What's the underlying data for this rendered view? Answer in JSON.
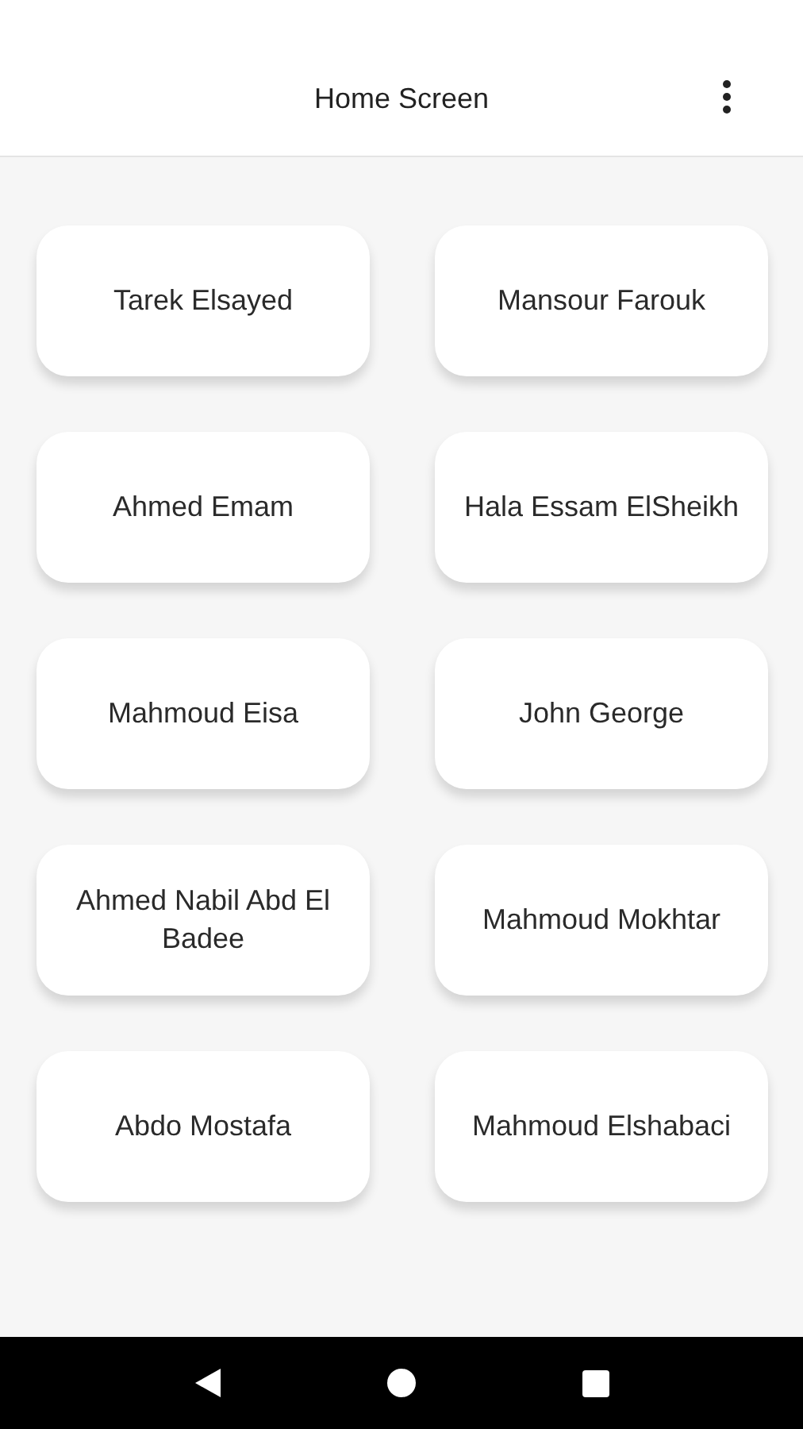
{
  "app_bar": {
    "title": "Home Screen"
  },
  "cards": [
    {
      "name": "Tarek Elsayed"
    },
    {
      "name": "Mansour Farouk"
    },
    {
      "name": "Ahmed Emam"
    },
    {
      "name": "Hala Essam ElSheikh"
    },
    {
      "name": "Mahmoud Eisa"
    },
    {
      "name": "John George"
    },
    {
      "name": "Ahmed Nabil Abd El Badee"
    },
    {
      "name": "Mahmoud Mokhtar"
    },
    {
      "name": "Abdo Mostafa"
    },
    {
      "name": "Mahmoud Elshabaci"
    }
  ]
}
